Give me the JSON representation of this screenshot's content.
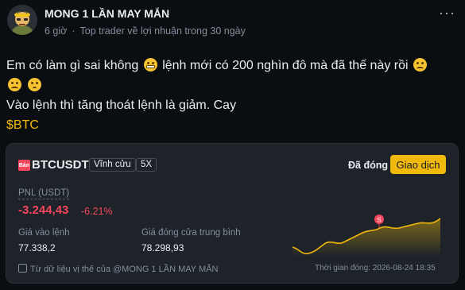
{
  "post": {
    "author": "MONG 1 LẦN MAY MẮN",
    "time": "6 giờ",
    "separator": "·",
    "badge": "Top trader về lợi nhuận trong 30 ngày",
    "more_icon": "···",
    "body": {
      "line1_a": "Em có làm gì sai không",
      "line1_b": "lệnh mới có 200 nghìn đô mà đã thế này rồi",
      "line3": "Vào lệnh thì tăng thoát lệnh là giảm. Cay",
      "ticker": "$BTC"
    }
  },
  "card": {
    "flag_text": "Bán",
    "pair": "BTCUSDT",
    "contract_type": "Vĩnh cửu",
    "leverage": "5X",
    "status": "Đã đóng",
    "trade_button": "Giao dịch",
    "pnl_label": "PNL (USDT)",
    "pnl_value": "-3.244,43",
    "pnl_percent": "-6.21%",
    "entry_label": "Giá vào lệnh",
    "entry_price": "77.338,2",
    "close_label": "Giá đóng cửa trung bình",
    "close_price": "78.298,93",
    "closed_time": "Thời gian đóng: 2026-08-24 18:35",
    "disclaimer": "Từ dữ liệu vị thế của @MONG 1 LẦN MAY MẮN",
    "marker_label": "S",
    "colors": {
      "loss": "#f6465d",
      "accent": "#f0b90b",
      "card_bg": "#1e2329",
      "page_bg": "#0b0e11"
    }
  }
}
